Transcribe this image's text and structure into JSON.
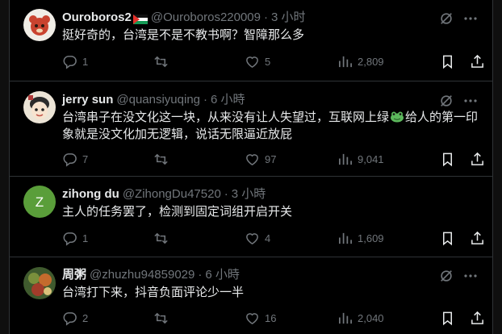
{
  "tweets": [
    {
      "name": "Ouroboros2",
      "handle": "@Ouroboros220009",
      "sep": "·",
      "time": "3 小时",
      "text": "挺好奇的，台湾是不是不教书啊？智障那么多",
      "replies": "1",
      "retweets": "",
      "likes": "5",
      "views": "2,809",
      "avatar_color": "#f0ede6"
    },
    {
      "name": "jerry sun",
      "handle": "@quansiyuqing",
      "sep": "·",
      "time": "6 小時",
      "text_before_emoji": "台湾串子在没文化这一块，从来没有让人失望过，互联网上绿",
      "emoji": "frog-emoji",
      "text_after_emoji": "给人的第一印象就是没文化加无逻辑，说话无限逼近放屁",
      "replies": "7",
      "retweets": "",
      "likes": "97",
      "views": "9,041",
      "avatar_color": "#ece4d6"
    },
    {
      "name": "zihong du",
      "handle": "@ZihongDu47520",
      "sep": "·",
      "time": "3 小時",
      "avatar_letter": "Z",
      "text": "主人的任务罢了，检测到固定词组开启开关",
      "replies": "1",
      "retweets": "",
      "likes": "4",
      "views": "1,609",
      "avatar_color": "#5a9e3a"
    },
    {
      "name": "周粥",
      "handle": "@zhuzhu94859029",
      "sep": "·",
      "time": "6 小時",
      "text": "台湾打下来，抖音负面评论少一半",
      "replies": "2",
      "retweets": "",
      "likes": "16",
      "views": "2,040",
      "avatar_color": "#3f5a2e"
    }
  ],
  "icons": {
    "reply": "reply-icon",
    "retweet": "retweet-icon",
    "like": "heart-icon",
    "views": "views-bar-icon",
    "bookmark": "bookmark-icon",
    "share": "share-icon",
    "grok": "grok-icon",
    "more": "more-icon"
  },
  "colors": {
    "background": "#000000",
    "text": "#e7e9ea",
    "muted": "#71767b",
    "divider": "#2f3336"
  }
}
